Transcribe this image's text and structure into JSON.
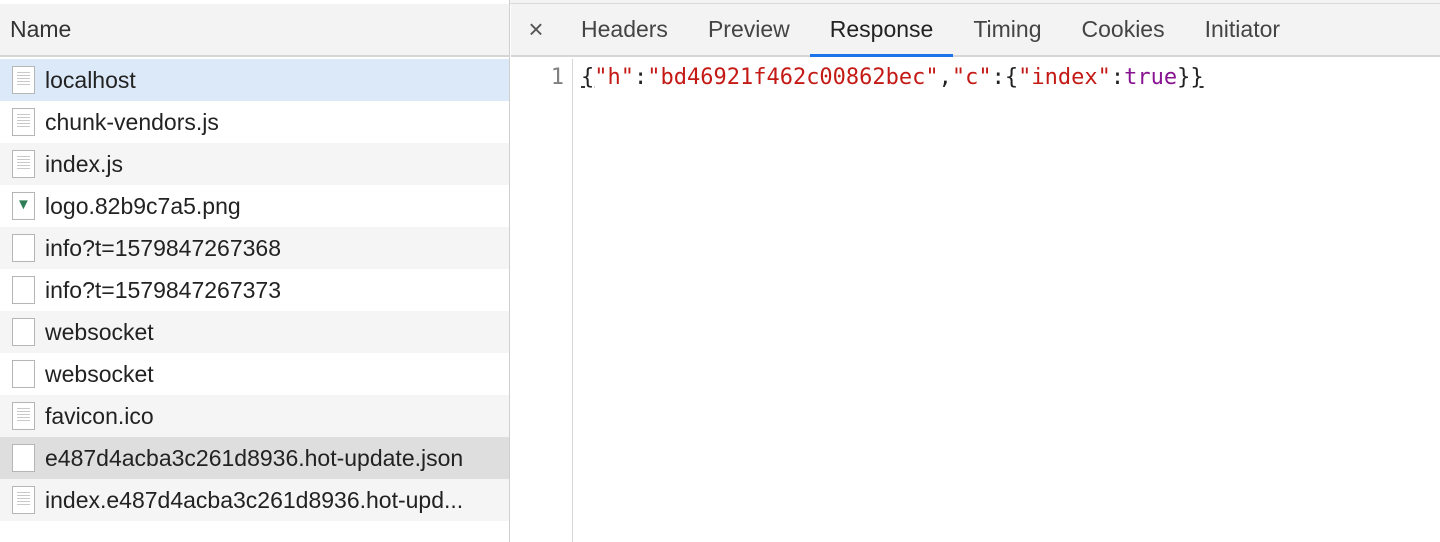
{
  "network_list": {
    "header": "Name",
    "rows": [
      {
        "name": "localhost",
        "icon": "document-icon"
      },
      {
        "name": "chunk-vendors.js",
        "icon": "document-icon"
      },
      {
        "name": "index.js",
        "icon": "document-icon"
      },
      {
        "name": "logo.82b9c7a5.png",
        "icon": "image-icon"
      },
      {
        "name": "info?t=1579847267368",
        "icon": "blank-file-icon"
      },
      {
        "name": "info?t=1579847267373",
        "icon": "blank-file-icon"
      },
      {
        "name": "websocket",
        "icon": "blank-file-icon"
      },
      {
        "name": "websocket",
        "icon": "blank-file-icon"
      },
      {
        "name": "favicon.ico",
        "icon": "document-icon"
      },
      {
        "name": "e487d4acba3c261d8936.hot-update.json",
        "icon": "blank-file-icon"
      },
      {
        "name": "index.e487d4acba3c261d8936.hot-upd...",
        "icon": "document-icon"
      }
    ]
  },
  "detail": {
    "close_glyph": "×",
    "tabs": [
      "Headers",
      "Preview",
      "Response",
      "Timing",
      "Cookies",
      "Initiator"
    ],
    "active_tab": "Response",
    "response": {
      "line_number": "1",
      "tokens": {
        "open_brace": "{",
        "key1": "\"h\"",
        "colon1": ":",
        "val1": "\"bd46921f462c00862bec\"",
        "comma": ",",
        "key2": "\"c\"",
        "colon2": ":",
        "inner_open": "{",
        "key3": "\"index\"",
        "colon3": ":",
        "val3": "true",
        "inner_close": "}",
        "close_brace": "}"
      }
    }
  },
  "colors": {
    "selected_row": "#dce9f8",
    "active_tab_underline": "#1a73e8",
    "json_string": "#c41a16",
    "json_boolean": "#881391"
  }
}
